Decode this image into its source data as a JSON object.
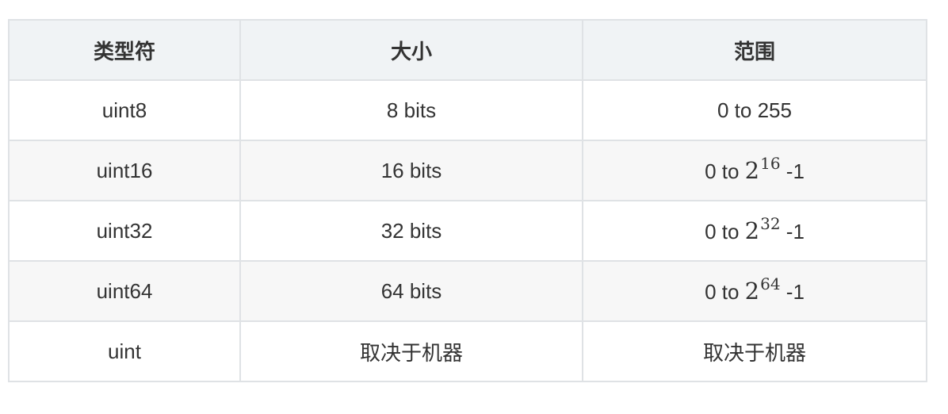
{
  "table": {
    "headers": [
      "类型符",
      "大小",
      "范围"
    ],
    "rows": [
      {
        "type": "uint8",
        "size": "8 bits",
        "range_text": "0 to 255"
      },
      {
        "type": "uint16",
        "size": "16 bits",
        "range_prefix": "0 to ",
        "range_base": "2",
        "range_exp": "16",
        "range_suffix": " -1"
      },
      {
        "type": "uint32",
        "size": "32 bits",
        "range_prefix": "0 to ",
        "range_base": "2",
        "range_exp": "32",
        "range_suffix": " -1"
      },
      {
        "type": "uint64",
        "size": "64 bits",
        "range_prefix": "0 to ",
        "range_base": "2",
        "range_exp": "64",
        "range_suffix": " -1"
      },
      {
        "type": "uint",
        "size": "取决于机器",
        "range_text": "取决于机器"
      }
    ]
  }
}
